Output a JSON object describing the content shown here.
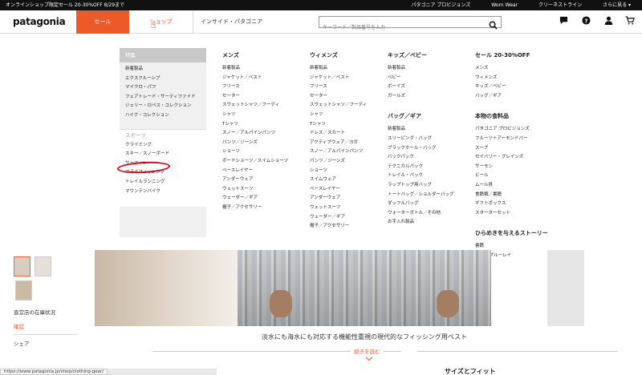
{
  "topbar": {
    "promo": "オンラインショップ限定セール 20-30%OFF 8/29まで",
    "links": [
      "パタゴニア プロビジョンズ",
      "Worn Wear",
      "クリーネストライン",
      "さらに見る ▾"
    ]
  },
  "header": {
    "logo": "patagonia",
    "nav_sale": "セール",
    "nav_shop": "ショップ",
    "nav_inside": "インサイド・パタゴニア",
    "search_placeholder": "キーワード／製品番号を入力",
    "icons": [
      "chat-icon",
      "help-icon",
      "account-icon",
      "cart-icon"
    ]
  },
  "mega": {
    "featured": {
      "head": "特集",
      "items": [
        "新着製品",
        "エクスクルーシブ",
        "マイクロ・パフ",
        "フェアトレード・サーティファイド",
        "ジェリー・ロペス・コレクション",
        "ハイク・コレクション"
      ]
    },
    "sports": {
      "head": "スポーツ",
      "items": [
        "クライミング",
        "スキー／スノーボード",
        "サーフィン",
        "フライフィッシング",
        "トレイルランニング",
        "マウンテンバイク"
      ]
    },
    "mens": {
      "head": "メンズ",
      "items": [
        "新着製品",
        "ジャケット／ベスト",
        "フリース",
        "セーター",
        "スウェットシャツ／フーディ",
        "シャツ",
        "Tシャツ",
        "スノー／アルパインパンツ",
        "パンツ／ジーンズ",
        "ショーツ",
        "ボードショーツ／スイムショーツ",
        "ベースレイヤー",
        "アンダーウェア",
        "ウェットスーツ",
        "ウェーダー／ギア",
        "帽子／アクセサリー"
      ]
    },
    "womens": {
      "head": "ウィメンズ",
      "items": [
        "新着製品",
        "ジャケット／ベスト",
        "フリース",
        "セーター",
        "スウェットシャツ／フーディ",
        "シャツ",
        "Tシャツ",
        "ドレス／スカート",
        "アクティブウェア／ヨガ",
        "スノー／アルパインパンツ",
        "パンツ／ジーンズ",
        "ショーツ",
        "スイムウェア",
        "ベースレイヤー",
        "アンダーウェア",
        "ウェットスーツ",
        "ウェーダー／ギア",
        "帽子／アクセサリー"
      ]
    },
    "kids": {
      "head": "キッズ／ベビー",
      "items": [
        "新着製品",
        "ベビー",
        "ボーイズ",
        "ガールズ"
      ]
    },
    "bags": {
      "head": "バッグ／ギア",
      "items": [
        "新着製品",
        "スリーピング・バッグ",
        "ブラックホール・バッグ",
        "バックパック",
        "テクニカルパック",
        "トレイル・パック",
        "ラップトップ用バッグ",
        "トートバッグ／ショルダーバッグ",
        "ダッフルバッグ",
        "ウォーターボトル／その他",
        "お手入れ製品"
      ]
    },
    "sale": {
      "head": "セール 20-30%OFF",
      "items": [
        "メンズ",
        "ウィメンズ",
        "キッズ／ベビー",
        "バッグ／ギア"
      ]
    },
    "food": {
      "head": "本物の食料品",
      "items": [
        "パタゴニア プロビジョンズ",
        "フルーツ＋アーモンドバー",
        "スープ",
        "セイバリー・グレインズ",
        "サーモン",
        "ビール",
        "ムール貝",
        "食籍類／書籍",
        "ギフトボックス",
        "スターターセット"
      ]
    },
    "stories": {
      "head": "ひらめきを与えるストーリー",
      "items": [
        "書籍",
        "DVD／ブルーレイ"
      ]
    }
  },
  "product": {
    "store_stock": "直営店の在庫状況",
    "confirm": "確認",
    "share": "シェア",
    "description": "淡水にも海水にも対応する機能性重視の現代的なフィッシング用ベスト",
    "read_more": "続きを読む",
    "size_fit": "サイズとフィット"
  },
  "status_url": "https://www.patagonia.jp/shop/clothing-gear/"
}
